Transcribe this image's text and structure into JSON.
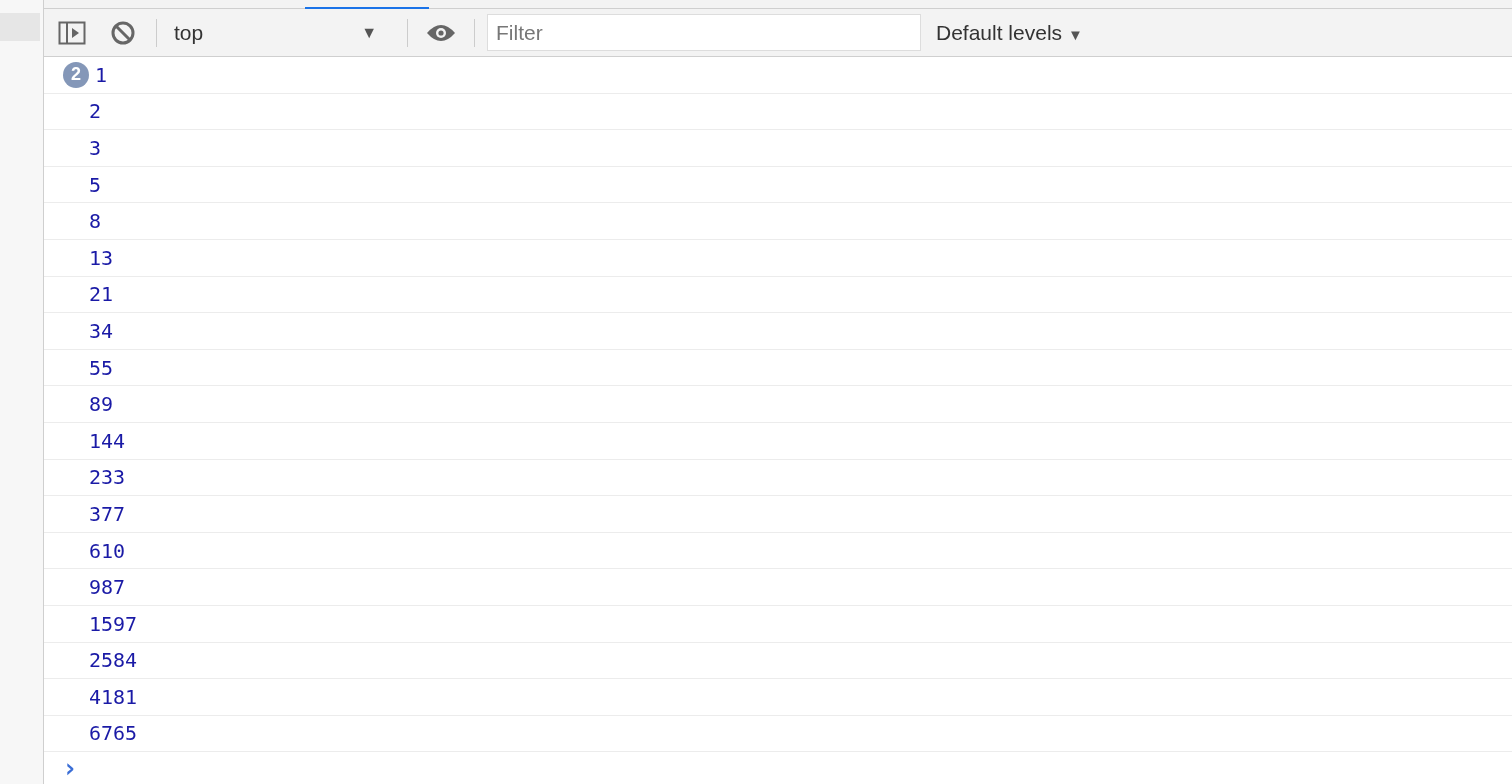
{
  "toolbar": {
    "context": "top",
    "filter": {
      "placeholder": "Filter"
    },
    "levels": "Default levels",
    "levels_arrow": "▼",
    "context_arrow": "▼"
  },
  "messages": [
    {
      "text": "1",
      "count": "2"
    },
    {
      "text": "2"
    },
    {
      "text": "3"
    },
    {
      "text": "5"
    },
    {
      "text": "8"
    },
    {
      "text": "13"
    },
    {
      "text": "21"
    },
    {
      "text": "34"
    },
    {
      "text": "55"
    },
    {
      "text": "89"
    },
    {
      "text": "144"
    },
    {
      "text": "233"
    },
    {
      "text": "377"
    },
    {
      "text": "610"
    },
    {
      "text": "987"
    },
    {
      "text": "1597"
    },
    {
      "text": "2584"
    },
    {
      "text": "4181"
    },
    {
      "text": "6765"
    }
  ],
  "prompt": "›"
}
